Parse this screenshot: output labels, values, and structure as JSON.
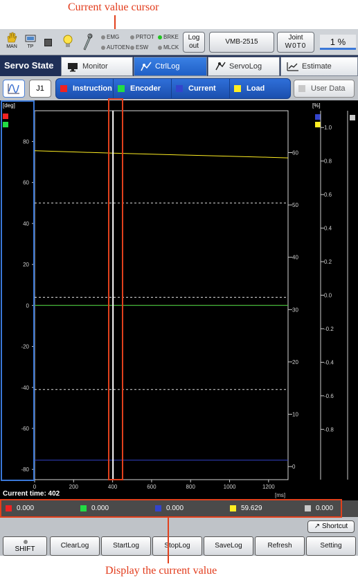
{
  "annotations": {
    "top_label": "Current value cursor",
    "bottom_label": "Display the current value"
  },
  "topbar": {
    "mode_icon": "hand-icon",
    "mode_label": "MAN",
    "tp_label": "TP",
    "indicators": [
      {
        "label": "EMG",
        "on": false
      },
      {
        "label": "AUTOEN",
        "on": false
      },
      {
        "label": "PRTOT",
        "on": false
      },
      {
        "label": "ESW",
        "on": false
      },
      {
        "label": "BRKE",
        "on": true
      },
      {
        "label": "MLCK",
        "on": false
      }
    ],
    "logout_label": "Log out",
    "robot_model": "VMB-2515",
    "joint_label": "Joint",
    "joint_value": "W0T0",
    "speed_value": "1 %"
  },
  "tabs": {
    "title": "Servo State",
    "items": [
      {
        "label": "Monitor",
        "active": false
      },
      {
        "label": "CtrlLog",
        "active": true
      },
      {
        "label": "ServoLog",
        "active": false
      },
      {
        "label": "Estimate",
        "active": false
      }
    ]
  },
  "channels": {
    "joint": "J1",
    "items": [
      {
        "label": "Instruction",
        "color": "#ee2222"
      },
      {
        "label": "Encoder",
        "color": "#22dd44"
      },
      {
        "label": "Current",
        "color": "#3344cc"
      },
      {
        "label": "Load",
        "color": "#ffee22"
      }
    ],
    "user_data_label": "User Data",
    "user_data_color": "#c8c8c8"
  },
  "chart_data": {
    "type": "line",
    "xlabel": "[ms]",
    "ylabel_left": "[deg]",
    "ylabel_right": "[%]",
    "xlim": [
      0,
      1300
    ],
    "xticks": [
      0,
      200,
      400,
      600,
      800,
      1000,
      1200
    ],
    "ylim_left": [
      -85,
      95
    ],
    "yticks_left": [
      80,
      60,
      40,
      20,
      0,
      -20,
      -40,
      -60,
      -80
    ],
    "ylim_mid": [
      -2.5,
      68
    ],
    "yticks_mid": [
      60,
      50,
      40,
      30,
      20,
      10,
      0
    ],
    "ylim_right": [
      -1.1,
      1.1
    ],
    "yticks_right": [
      1.0,
      0.8,
      0.6,
      0.4,
      0.2,
      0.0,
      -0.2,
      -0.4,
      -0.6,
      -0.8
    ],
    "dashed_lines_left": [
      50,
      4,
      -41
    ],
    "cursor_x": 402,
    "series": [
      {
        "name": "Instruction",
        "color": "#ee2222",
        "x": [
          0,
          1300
        ],
        "y": [
          0,
          0
        ]
      },
      {
        "name": "Encoder",
        "color": "#22dd44",
        "x": [
          0,
          1300
        ],
        "y": [
          0,
          0
        ]
      },
      {
        "name": "Current",
        "color": "#3344cc",
        "x": [
          0,
          1300
        ],
        "y": [
          -75.5,
          -75.5
        ]
      },
      {
        "name": "Load",
        "color": "#ffee22",
        "x": [
          0,
          200,
          402,
          600,
          800,
          1000,
          1200,
          1300
        ],
        "y": [
          75.5,
          74.9,
          74.3,
          73.8,
          73.3,
          72.8,
          72.3,
          72.0
        ]
      }
    ]
  },
  "current_time": "Current time: 402",
  "current_values": [
    {
      "color": "#ee2222",
      "value": "0.000"
    },
    {
      "color": "#22dd44",
      "value": "0.000"
    },
    {
      "color": "#3344cc",
      "value": "0.000"
    },
    {
      "color": "#ffee22",
      "value": "59.629"
    },
    {
      "color": "#c8c8c8",
      "value": "0.000"
    }
  ],
  "footer": {
    "shortcut_label": "Shortcut",
    "buttons": [
      "SHIFT",
      "ClearLog",
      "StartLog",
      "StopLog",
      "SaveLog",
      "Refresh",
      "Setting"
    ]
  }
}
